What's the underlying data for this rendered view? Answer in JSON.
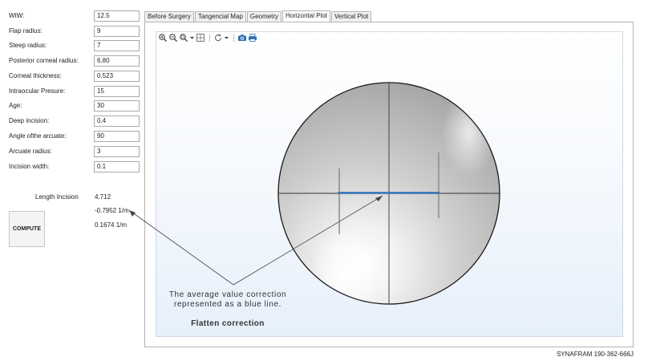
{
  "form": {
    "fields": [
      {
        "label": "WtW:",
        "value": "12.5"
      },
      {
        "label": "Flap radius:",
        "value": "9"
      },
      {
        "label": "Steep radius:",
        "value": "7"
      },
      {
        "label": "Posterior corneal radius:",
        "value": "6.80"
      },
      {
        "label": "Corneal thickness:",
        "value": "0.523"
      },
      {
        "label": "Intraocular Presure:",
        "value": "15"
      },
      {
        "label": "Age:",
        "value": "30"
      },
      {
        "label": "Deep incision:",
        "value": "0.4"
      },
      {
        "label": "Angle ofthe arcuate:",
        "value": "90"
      },
      {
        "label": "Arcuate radius:",
        "value": "3"
      },
      {
        "label": "Incision width:",
        "value": "0.1"
      }
    ]
  },
  "results": {
    "length_label": "Length Incision",
    "length_value": "4.712",
    "correction_1": "-0.7952 1/m",
    "correction_2": "0.1674 1/m"
  },
  "compute_button": {
    "label": "COMPUTE"
  },
  "tabs": [
    {
      "label": "Before Surgery",
      "active": false
    },
    {
      "label": "Tangencial Map",
      "active": false
    },
    {
      "label": "Geometry",
      "active": false
    },
    {
      "label": "Horizontal Plot",
      "active": true
    },
    {
      "label": "Vertical Plot",
      "active": false
    }
  ],
  "toolbar": {
    "icons": [
      "zoom-in-icon",
      "zoom-out-icon",
      "zoom-box-icon",
      "dropdown-arrow-icon",
      "fit-view-icon",
      "rotate-icon",
      "dropdown-arrow-icon",
      "camera-icon",
      "print-icon"
    ]
  },
  "plot": {
    "correction_line_color": "#2f6fb3"
  },
  "annotation": {
    "line1": "The average value correction",
    "line2": "represented as a blue line.",
    "line3": "Flatten correction"
  },
  "footer": {
    "text": "SYNAFRAM  190-362-666J"
  }
}
